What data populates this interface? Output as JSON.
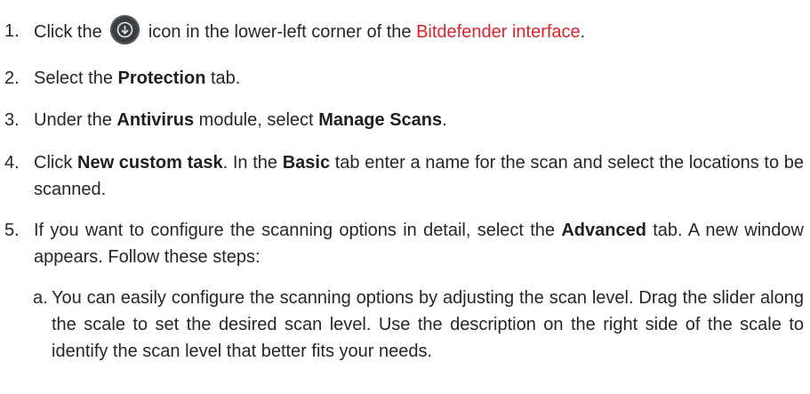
{
  "steps": [
    {
      "num": "1.",
      "pre": "Click the",
      "icon": "download-arrow-icon",
      "mid": "icon in the lower-left corner of the",
      "link": "Bitdefender interface",
      "post": "."
    },
    {
      "num": "2.",
      "pre": "Select the",
      "bold": "Protection",
      "post": "tab."
    },
    {
      "num": "3.",
      "pre": "Under the",
      "bold1": "Antivirus",
      "mid": "module, select",
      "bold2": "Manage Scans",
      "post": "."
    },
    {
      "num": "4.",
      "pre": "Click",
      "bold1": "New custom task",
      "mid": ". In the",
      "bold2": "Basic",
      "post": "tab enter a name for the scan and select the locations to be scanned."
    },
    {
      "num": "5.",
      "pre": "If you want to configure the scanning options in detail, select the",
      "bold": "Advanced",
      "post": "tab. A new window appears. Follow these steps:"
    }
  ],
  "substeps": [
    {
      "num": "a.",
      "text": "You can easily configure the scanning options by adjusting the scan level. Drag the slider along the scale to set the desired scan level. Use the description on the right side of the scale to identify the scan level that better fits your needs."
    }
  ]
}
